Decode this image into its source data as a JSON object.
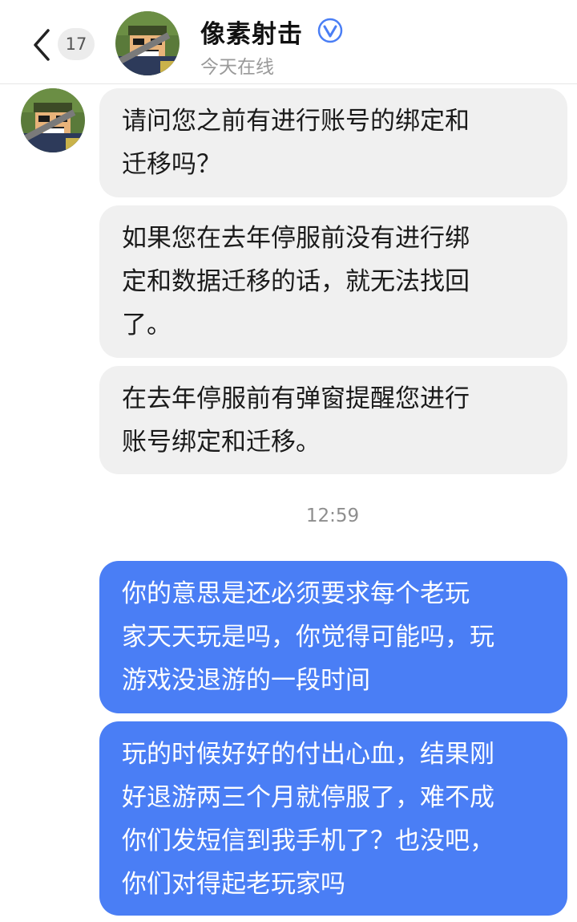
{
  "header": {
    "unread_count": "17",
    "title": "像素射击",
    "status": "今天在线",
    "verified_icon": "verified-badge-icon",
    "back_icon": "chevron-left-icon"
  },
  "messages": [
    {
      "sender": "other",
      "lines": [
        "请问您之前有进行账号的绑定和",
        "迁移吗？"
      ]
    },
    {
      "sender": "other",
      "lines": [
        "如果您在去年停服前没有进行绑",
        "定和数据迁移的话，就无法找回",
        "了。"
      ]
    },
    {
      "sender": "other",
      "lines": [
        "在去年停服前有弹窗提醒您进行",
        "账号绑定和迁移。"
      ]
    },
    {
      "sender": "me",
      "lines": [
        "你的意思是还必须要求每个老玩",
        "家天天玩是吗，你觉得可能吗，玩",
        "游戏没退游的一段时间"
      ]
    },
    {
      "sender": "me",
      "lines": [
        "玩的时候好好的付出心血，结果刚",
        "好退游两三个月就停服了，难不成",
        "你们发短信到我手机了？也没吧，",
        "你们对得起老玩家吗"
      ]
    }
  ],
  "timestamp": "12:59",
  "colors": {
    "accent": "#4a7ef5",
    "incoming_bubble": "#f0f0f0",
    "verified": "#4a7ef5"
  }
}
